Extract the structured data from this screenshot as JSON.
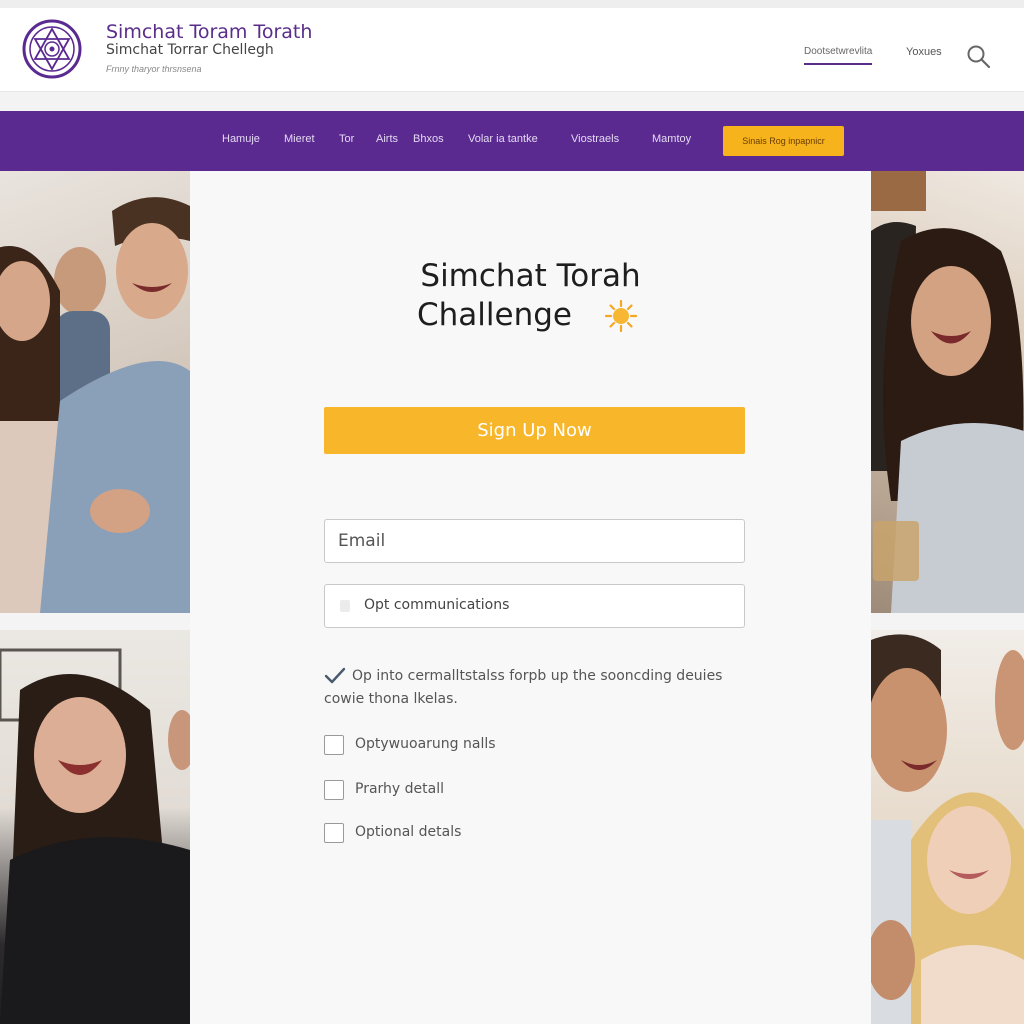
{
  "header": {
    "title": "Simchat Toram Torath",
    "subtitle": "Simchat Torrar Chellegh",
    "tagline": "Frnny tharyor thrsnsena",
    "links": [
      "Dootsetwrevlita",
      "Yoxues"
    ]
  },
  "nav": {
    "items": [
      "Hamuje",
      "Mieret",
      "Tor",
      "Airts",
      "Bhxos",
      "Volar ia tantke",
      "Viostraels",
      "Mamtoy"
    ],
    "cta": "Sinais Rog inpapnicr"
  },
  "card": {
    "title_line1": "Simchat Torah",
    "title_line2": "Challenge",
    "signup_label": "Sign Up Now",
    "email_placeholder": "Email",
    "opt_field_text": "Opt communications",
    "optin_line1": "Op into cermalltstalss forpb up the sooncding deuies",
    "optin_line2": "cowie thona lkelas.",
    "checkboxes": [
      "Optywuoarung nalls",
      "Prarhy detall",
      "Optional detals"
    ]
  },
  "colors": {
    "brand_purple": "#5b2a91",
    "accent_yellow": "#f8b62b"
  },
  "icons": [
    "logo-emblem",
    "search-icon",
    "sun-icon",
    "check-icon"
  ]
}
